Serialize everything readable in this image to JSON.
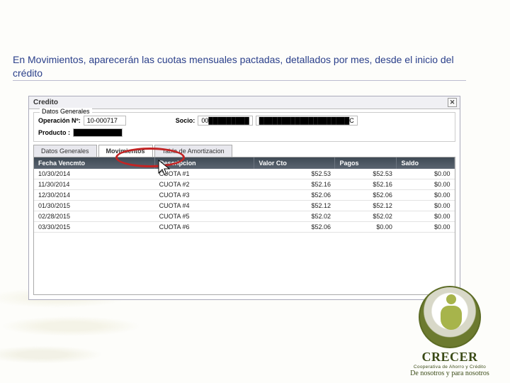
{
  "caption": "En Movimientos, aparecerán las cuotas mensuales pactadas, detallados por mes, desde el inicio del crédito",
  "window": {
    "title": "Credito",
    "group_legend": "Datos Generales",
    "fields": {
      "operacion_label": "Operación Nº:",
      "operacion_value": "10-000717",
      "socio_label": "Socio:",
      "socio_value_a": "00█████████",
      "socio_value_b": "████████████████████C",
      "producto_label": "Producto :",
      "producto_value": "███████████"
    },
    "tabs": {
      "datos": "Datos Generales",
      "mov": "Movimientos",
      "tabla": "Tabla de Amortizacion"
    },
    "columns": {
      "fecha": "Fecha Vencmto",
      "desc": "Descripcion",
      "valor": "Valor Cto",
      "pagos": "Pagos",
      "saldo": "Saldo"
    },
    "rows": [
      {
        "fecha": "10/30/2014",
        "desc": "CUOTA #1",
        "valor": "$52.53",
        "pagos": "$52.53",
        "saldo": "$0.00"
      },
      {
        "fecha": "11/30/2014",
        "desc": "CUOTA #2",
        "valor": "$52.16",
        "pagos": "$52.16",
        "saldo": "$0.00"
      },
      {
        "fecha": "12/30/2014",
        "desc": "CUOTA #3",
        "valor": "$52.06",
        "pagos": "$52.06",
        "saldo": "$0.00"
      },
      {
        "fecha": "01/30/2015",
        "desc": "CUOTA #4",
        "valor": "$52.12",
        "pagos": "$52.12",
        "saldo": "$0.00"
      },
      {
        "fecha": "02/28/2015",
        "desc": "CUOTA #5",
        "valor": "$52.02",
        "pagos": "$52.02",
        "saldo": "$0.00"
      },
      {
        "fecha": "03/30/2015",
        "desc": "CUOTA #6",
        "valor": "$52.06",
        "pagos": "$0.00",
        "saldo": "$0.00"
      }
    ]
  },
  "brand": {
    "title": "CRECER",
    "sub1": "Cooperativa de Ahorro y Crédito",
    "sub2": "De nosotros y para nosotros"
  }
}
